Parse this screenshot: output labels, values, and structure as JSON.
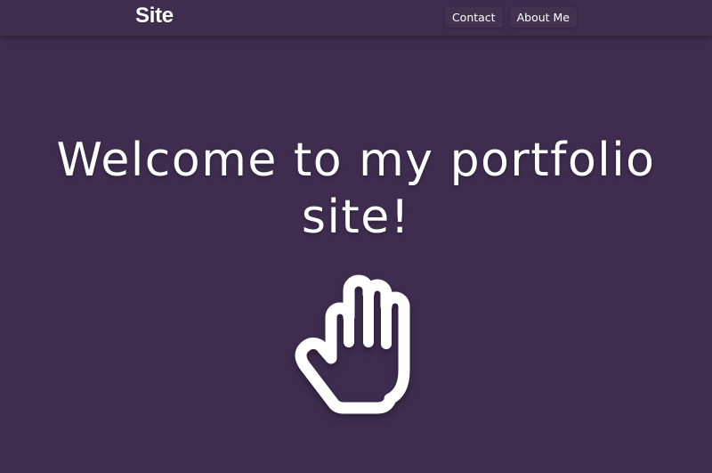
{
  "nav": {
    "brand": "Site",
    "links": [
      {
        "label": "Contact"
      },
      {
        "label": "About Me"
      }
    ]
  },
  "hero": {
    "title": "Welcome to my portfolio site!",
    "icon": "hand-icon"
  },
  "colors": {
    "background": "#3e2d4f",
    "text": "#ffffff"
  }
}
